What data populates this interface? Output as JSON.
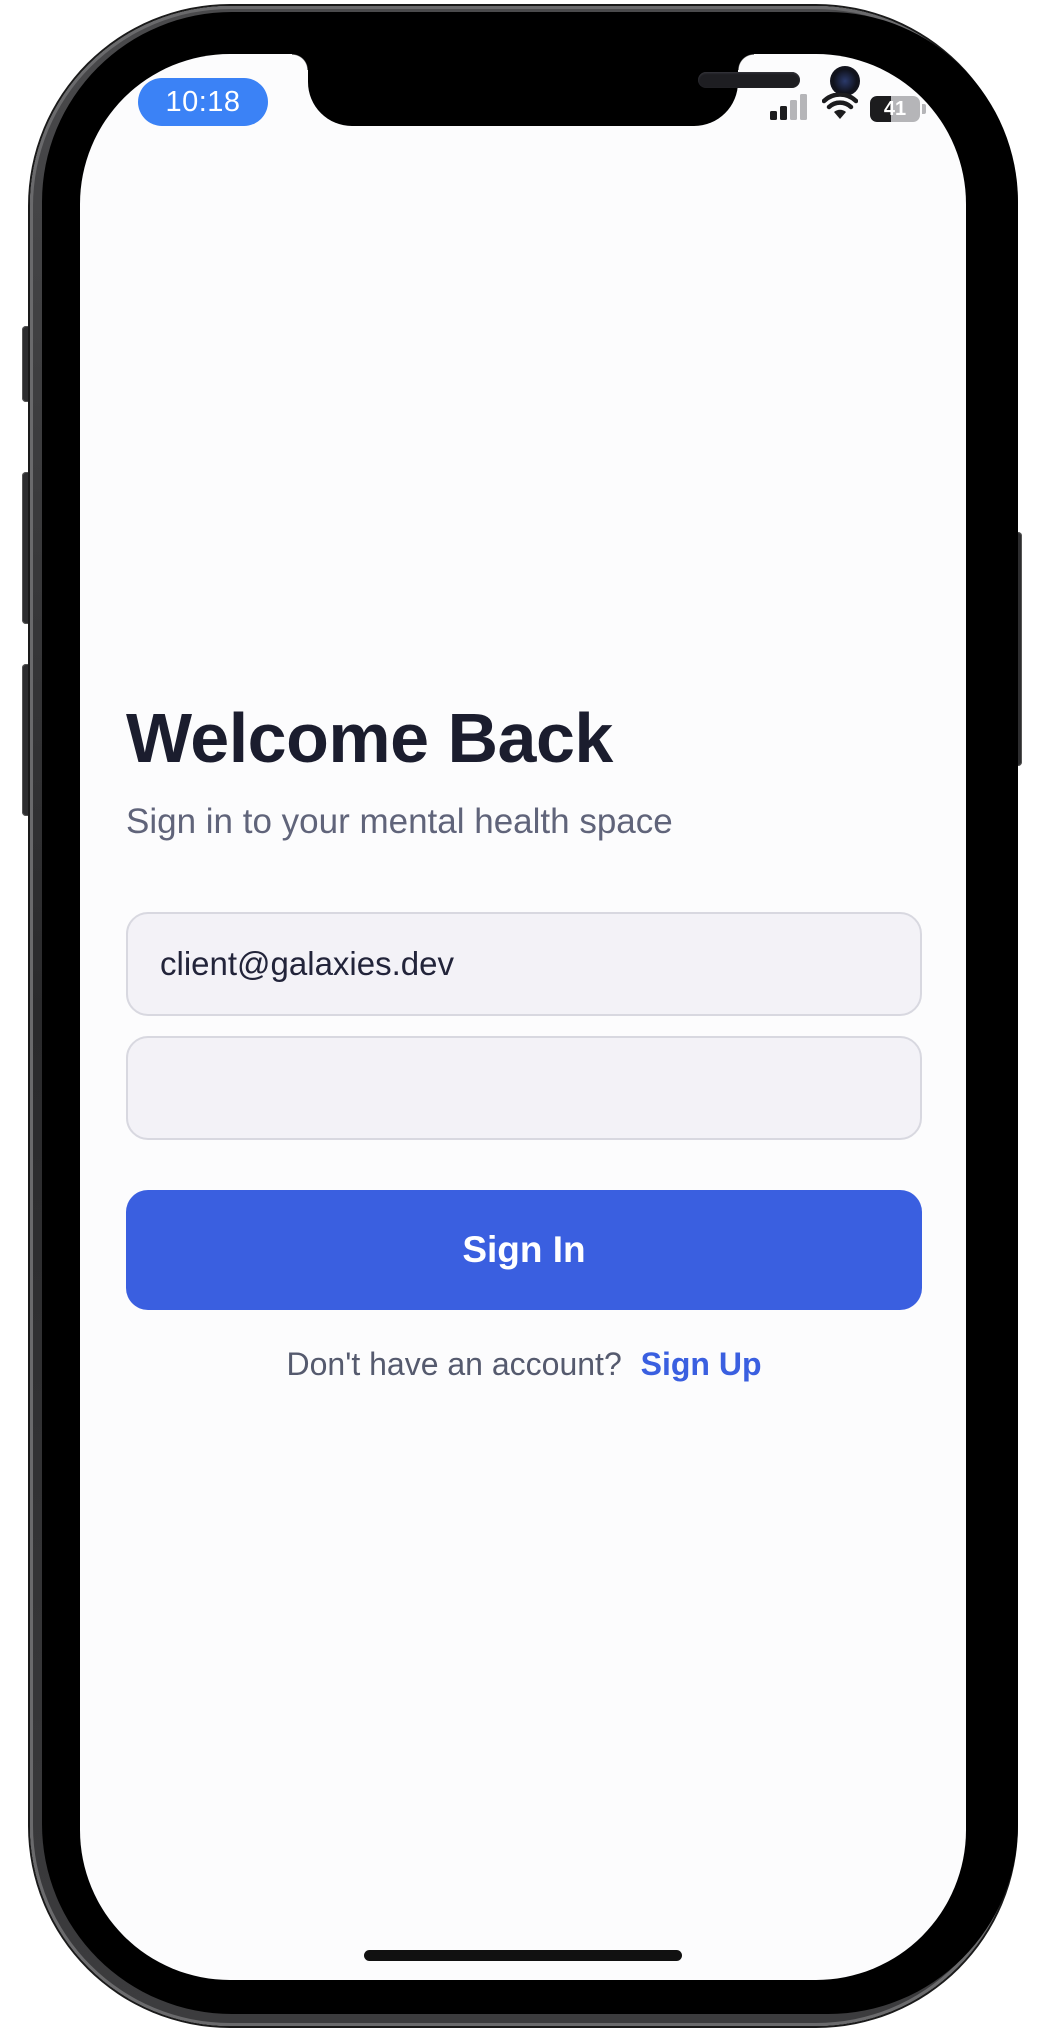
{
  "status_bar": {
    "time": "10:18",
    "battery_level": "41",
    "battery_fraction": 0.41,
    "signal_icon": "cellular-signal-icon",
    "wifi_icon": "wifi-icon",
    "accent_color": "#3b82f6"
  },
  "login": {
    "title": "Welcome Back",
    "subtitle": "Sign in to your mental health space",
    "email_value": "client@galaxies.dev",
    "password_value": "",
    "signin_label": "Sign In",
    "signup_prompt": "Don't have an account?",
    "signup_link": "Sign Up",
    "primary_color": "#3a5fe0"
  }
}
